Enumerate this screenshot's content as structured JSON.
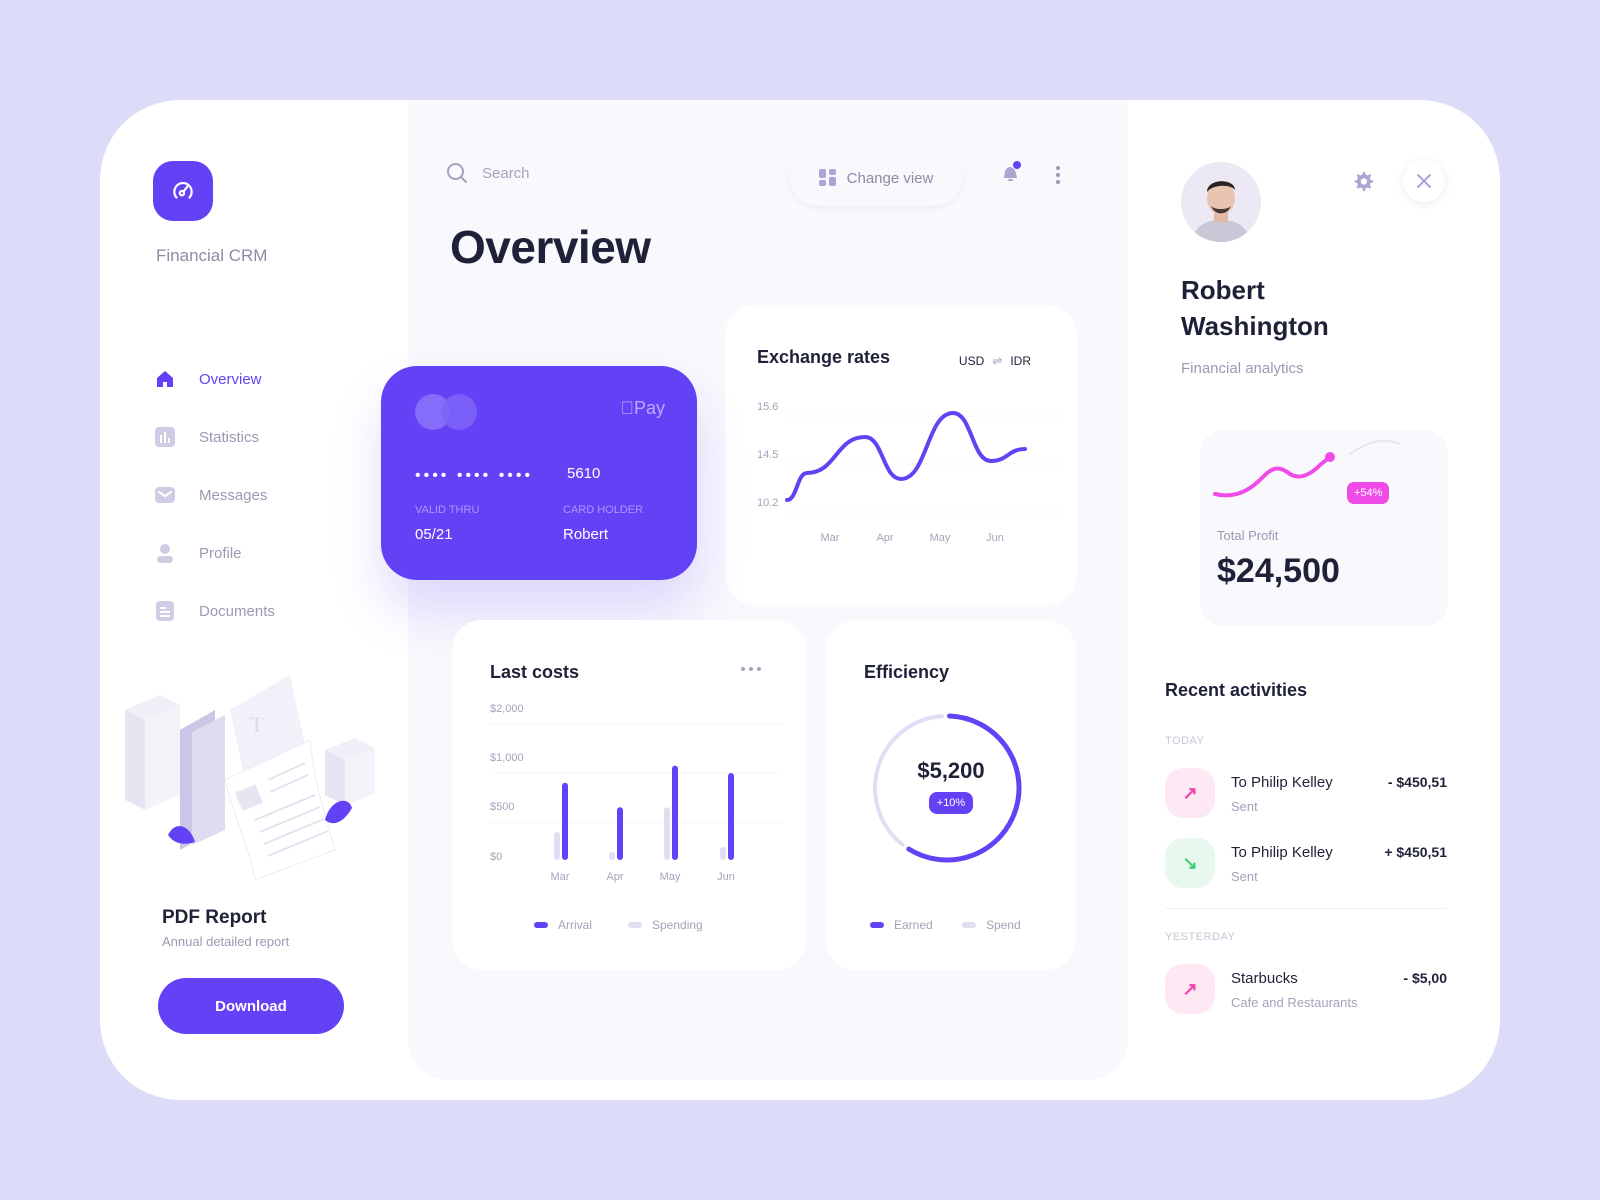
{
  "app": {
    "brand": "Financial CRM",
    "logo_icon": "speedometer-icon"
  },
  "sidebar": {
    "items": [
      {
        "label": "Overview",
        "icon": "home-icon",
        "active": true
      },
      {
        "label": "Statistics",
        "icon": "bar-chart-icon",
        "active": false
      },
      {
        "label": "Messages",
        "icon": "mail-icon",
        "active": false
      },
      {
        "label": "Profile",
        "icon": "user-icon",
        "active": false
      },
      {
        "label": "Documents",
        "icon": "document-icon",
        "active": false
      }
    ],
    "report": {
      "title": "PDF Report",
      "subtitle": "Annual detailed report",
      "button": "Download"
    }
  },
  "topbar": {
    "search_placeholder": "Search",
    "change_view": "Change view",
    "notifications_unread": true
  },
  "main": {
    "title": "Overview",
    "card": {
      "brand": "Pay",
      "masked": "•••• •••• ••••",
      "last4": "5610",
      "valid_label": "VALID THRU",
      "valid_value": "05/21",
      "holder_label": "CARD HOLDER",
      "holder_value": "Robert"
    },
    "exchange": {
      "title": "Exchange rates",
      "from": "USD",
      "swap": "⇌",
      "to": "IDR"
    },
    "last_costs": {
      "title": "Last costs"
    },
    "efficiency": {
      "title": "Efficiency",
      "value": "$5,200",
      "change": "+10%",
      "legend": [
        "Earned",
        "Spend"
      ]
    }
  },
  "chart_data": [
    {
      "type": "line",
      "title": "Exchange rates",
      "categories": [
        "Mar",
        "Apr",
        "May",
        "Jun"
      ],
      "y_ticks": [
        "15.6",
        "14.5",
        "10.2"
      ],
      "series": [
        {
          "name": "USD/IDR",
          "values": [
            10.0,
            11.8,
            14.2,
            11.4,
            15.8,
            12.6,
            13.4
          ]
        }
      ],
      "x_points": [
        "start",
        "Mar",
        "Apr-",
        "Apr+",
        "May",
        "Jun-",
        "end"
      ],
      "color": "#6342f5"
    },
    {
      "type": "bar",
      "title": "Last costs",
      "categories": [
        "Mar",
        "Apr",
        "May",
        "Jun"
      ],
      "y_ticks": [
        "$2,000",
        "$1,000",
        "$500",
        "$0"
      ],
      "ylim": [
        0,
        2000
      ],
      "series": [
        {
          "name": "Arrival",
          "values": [
            900,
            650,
            1150,
            1000
          ],
          "color": "#6342f5"
        },
        {
          "name": "Spending",
          "values": [
            400,
            200,
            650,
            250
          ],
          "color": "#e0def2"
        }
      ]
    },
    {
      "type": "pie",
      "title": "Efficiency",
      "center_label": "$5,200",
      "series": [
        {
          "name": "Earned",
          "value": 60,
          "color": "#6342f5"
        },
        {
          "name": "Spend",
          "value": 40,
          "color": "#e0def2"
        }
      ]
    }
  ],
  "user": {
    "name": "Robert Washington",
    "role": "Financial analytics",
    "profit_label": "Total Profit",
    "profit_value": "$24,500",
    "profit_change": "+54%"
  },
  "activities": {
    "title": "Recent activities",
    "groups": [
      {
        "label": "TODAY"
      },
      {
        "label": "YESTERDAY"
      }
    ],
    "items": [
      {
        "name": "To Philip Kelley",
        "sub": "Sent",
        "amount": "- $450,51",
        "direction": "out",
        "arrow": "↗"
      },
      {
        "name": "To Philip Kelley",
        "sub": "Sent",
        "amount": "+ $450,51",
        "direction": "in",
        "arrow": "↘"
      },
      {
        "name": "Starbucks",
        "sub": "Cafe and Restaurants",
        "amount": "- $5,00",
        "direction": "out",
        "arrow": "↗"
      }
    ]
  }
}
